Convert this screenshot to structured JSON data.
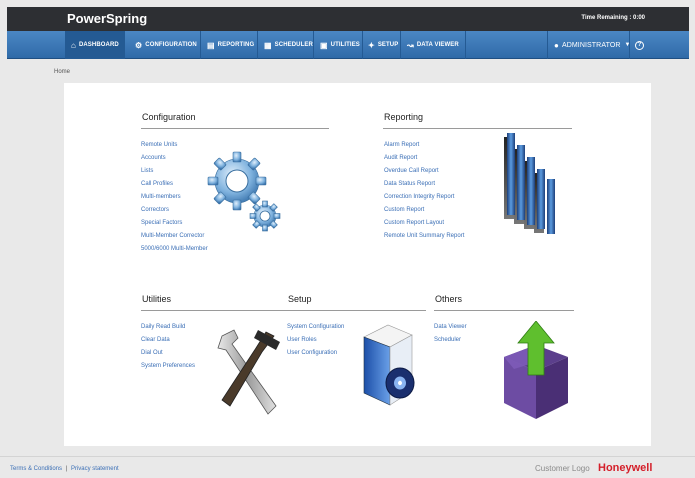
{
  "app": {
    "name": "PowerSpring",
    "time_remaining": "Time Remaining : 0:00"
  },
  "nav": {
    "items": [
      {
        "label": "DASHBOARD",
        "icon": "home-icon"
      },
      {
        "label": "CONFIGURATION",
        "icon": "gear-icon"
      },
      {
        "label": "REPORTING",
        "icon": "clipboard-icon"
      },
      {
        "label": "SCHEDULER",
        "icon": "calendar-icon"
      },
      {
        "label": "UTILITIES",
        "icon": "briefcase-icon"
      },
      {
        "label": "SETUP",
        "icon": "wrench-icon"
      },
      {
        "label": "DATA VIEWER",
        "icon": "line-chart-icon"
      }
    ],
    "user": "ADMINISTRATOR",
    "help_icon": "help-icon"
  },
  "breadcrumb": "Home",
  "sections": {
    "configuration": {
      "title": "Configuration",
      "links": [
        "Remote Units",
        "Accounts",
        "Lists",
        "Call Profiles",
        "Multi-members",
        "Correctors",
        "Special Factors",
        "Multi-Member Corrector",
        "5000/6000 Multi-Member"
      ]
    },
    "reporting": {
      "title": "Reporting",
      "links": [
        "Alarm Report",
        "Audit Report",
        "Overdue Call Report",
        "Data Status Report",
        "Correction Integrity Report",
        "Custom Report",
        "Custom Report Layout",
        "Remote Unit Summary Report"
      ]
    },
    "utilities": {
      "title": "Utilities",
      "links": [
        "Daily Read Build",
        "Clear Data",
        "Dial Out",
        "System Preferences"
      ]
    },
    "setup": {
      "title": "Setup",
      "links": [
        "System Configuration",
        "User Roles",
        "User Configuration"
      ]
    },
    "others": {
      "title": "Others",
      "links": [
        "Data Viewer",
        "Scheduler"
      ]
    }
  },
  "footer": {
    "terms": "Terms & Conditions",
    "privacy": "Privacy statement",
    "separator": "|",
    "customer_logo": "Customer Logo",
    "brand_logo": "Honeywell"
  },
  "colors": {
    "nav_blue": "#3a78b8",
    "topbar": "#2d2f33",
    "link_blue": "#3b6fb6",
    "honeywell_red": "#d41f2a"
  }
}
